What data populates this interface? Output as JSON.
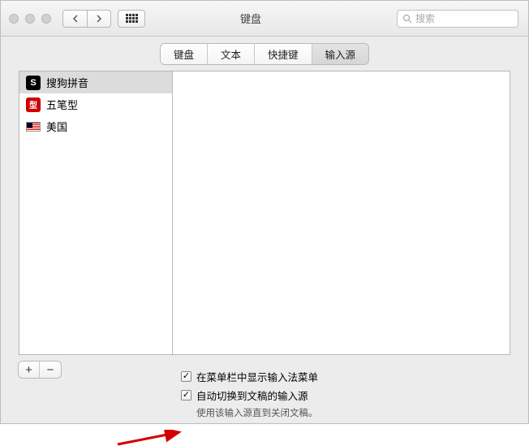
{
  "window": {
    "title": "键盘"
  },
  "search": {
    "placeholder": "搜索"
  },
  "tabs": {
    "items": [
      "键盘",
      "文本",
      "快捷键",
      "输入源"
    ],
    "active_index": 3
  },
  "sources": {
    "items": [
      {
        "label": "搜狗拼音",
        "icon": "sogou",
        "selected": true
      },
      {
        "label": "五笔型",
        "icon": "wubi",
        "selected": false
      },
      {
        "label": "美国",
        "icon": "us",
        "selected": false
      }
    ]
  },
  "buttons": {
    "add": "+",
    "remove": "−"
  },
  "options": {
    "show_menu": {
      "checked": true,
      "label": "在菜单栏中显示输入法菜单"
    },
    "auto_switch": {
      "checked": true,
      "label": "自动切换到文稿的输入源"
    },
    "hint": "使用该输入源直到关闭文稿。"
  },
  "annotation": {
    "arrow_target": "auto_switch"
  }
}
